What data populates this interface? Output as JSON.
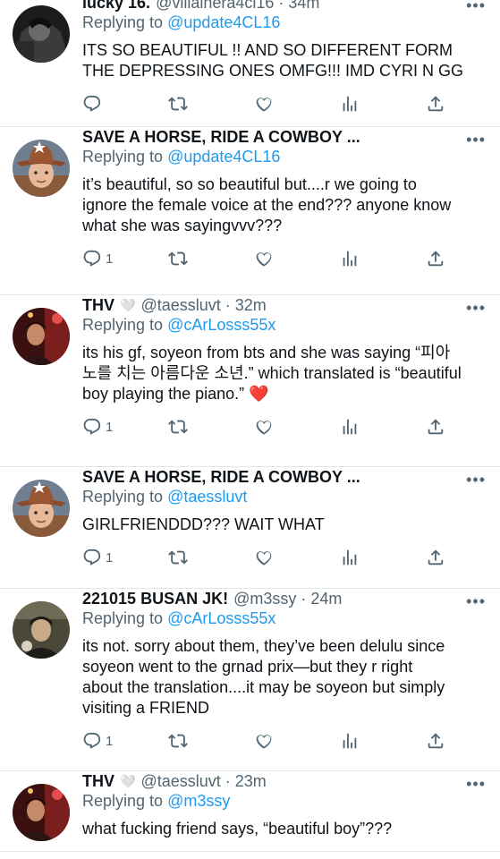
{
  "tweets": [
    {
      "name": "lucky 16.",
      "badge": "",
      "handle": "@villainera4cl16",
      "time": "34m",
      "reply_prefix": "Replying to ",
      "reply_to": "@update4CL16",
      "text": "ITS SO BEAUTIFUL !! AND SO DIFFERENT FORM\nTHE DEPRESSING ONES OMFG!!! IMD CYRI N GG",
      "reply_count": "",
      "avatar": "dark-bw"
    },
    {
      "name": "SAVE A HORSE, RIDE A COWBOY ...",
      "badge": "",
      "handle": "",
      "time": "",
      "reply_prefix": "Replying to ",
      "reply_to": "@update4CL16",
      "text": "it’s beautiful, so so beautiful but....r we going to\nignore the female voice at the end??? anyone know\nwhat she was sayingvvv???",
      "reply_count": "1",
      "avatar": "cowboy"
    },
    {
      "name": "THV",
      "badge": "🤍",
      "handle": "@taessluvt",
      "time": "32m",
      "reply_prefix": "Replying to ",
      "reply_to": "@cArLosss55x",
      "text": "its his gf, soyeon from bts and she was saying “피아\n노를 치는 아름다운 소년.” which translated is “beautiful\nboy playing the piano.” ❤️",
      "reply_count": "1",
      "avatar": "red-room"
    },
    {
      "name": "SAVE A HORSE, RIDE A COWBOY ...",
      "badge": "",
      "handle": "",
      "time": "",
      "reply_prefix": "Replying to ",
      "reply_to": "@taessluvt",
      "text": "GIRLFRIENDDD??? WAIT WHAT",
      "reply_count": "1",
      "avatar": "cowboy"
    },
    {
      "name": "221015 BUSAN JK!",
      "badge": "",
      "handle": "@m3ssy",
      "time": "24m",
      "reply_prefix": "Replying to ",
      "reply_to": "@cArLosss55x",
      "text": "its not. sorry about them, they’ve been delulu since\nsoyeon went to the grnad prix—but they r right\nabout the translation....it may be soyeon but simply\nvisiting a FRIEND",
      "reply_count": "1",
      "avatar": "dark-olive"
    },
    {
      "name": "THV",
      "badge": "🤍",
      "handle": "@taessluvt",
      "time": "23m",
      "reply_prefix": "Replying to ",
      "reply_to": "@m3ssy",
      "text": "what fucking friend says, “beautiful boy”???",
      "reply_count": "",
      "avatar": "red-room"
    }
  ],
  "icons": {
    "reply": "reply-icon",
    "retweet": "retweet-icon",
    "like": "heart-icon",
    "views": "analytics-icon",
    "share": "share-icon",
    "more": "more-icon"
  },
  "colors": {
    "link": "#1d9bf0",
    "secondary": "#536471",
    "text": "#0f1419",
    "divider": "#e1e8ed"
  },
  "more_glyph": "•••",
  "dot": "·"
}
